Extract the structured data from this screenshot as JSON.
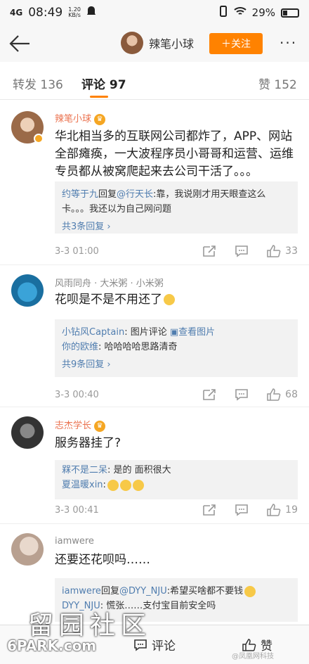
{
  "status": {
    "signal": "4G",
    "time": "08:49",
    "speed": "1.20",
    "speed_unit": "KB/s",
    "battery": "29%"
  },
  "nav": {
    "title": "辣笔小球",
    "follow_label": "＋关注",
    "more": "···"
  },
  "tabs": {
    "repost": "转发 136",
    "comment": "评论 97",
    "like": "赞 152"
  },
  "comments": [
    {
      "author": "辣笔小球",
      "text": "华北相当多的互联网公司都炸了，APP、网站全部瘫痪，一大波程序员小哥哥和运营、运维专员都从被窝爬起来去公司干活了。。。",
      "replies": [
        {
          "nick": "约等于九",
          "mid": "回复",
          "target": "@行天长",
          "body": ":靠，我说刚才用天眼查这么卡。。。我还以为自己网问题"
        }
      ],
      "more": "共3条回复 ›",
      "time": "3-3 01:00",
      "likes": "33"
    },
    {
      "author": "风雨同舟 · 大米粥 · 小米粥",
      "text": "花呗是不是不用还了",
      "replies": [
        {
          "nick": "小钻风Captain",
          "body": ": 图片评论 ",
          "link": "查看图片"
        },
        {
          "nick": "你的欧维",
          "body": ": 哈哈哈哈思路清奇"
        }
      ],
      "more": "共9条回复 ›",
      "time": "3-3 00:40",
      "likes": "68"
    },
    {
      "author": "志杰学长",
      "text": "服务器挂了?",
      "replies": [
        {
          "nick": "槑不是二呆",
          "body": ": 是的 面积很大"
        },
        {
          "nick": "夏温暖xin",
          "body": ":"
        }
      ],
      "time": "3-3 00:41",
      "likes": "19"
    },
    {
      "author": "iamwere",
      "text": "还要还花呗吗……",
      "replies": [
        {
          "nick": "iamwere",
          "mid": "回复",
          "target": "@DYY_NJU",
          "body": ":希望买啥都不要钱"
        },
        {
          "nick": "DYY_NJU",
          "body": ": 慌张……支付宝目前安全吗"
        }
      ]
    }
  ],
  "bottom": {
    "comment_label": "评论",
    "like_label": "赞"
  },
  "watermark": {
    "big": "留园社区",
    "url": "6PARK.com",
    "corner": "@凤凰网科技"
  },
  "colors": {
    "accent": "#ff8200",
    "link": "#507daf",
    "author_highlight": "#eb7350"
  }
}
